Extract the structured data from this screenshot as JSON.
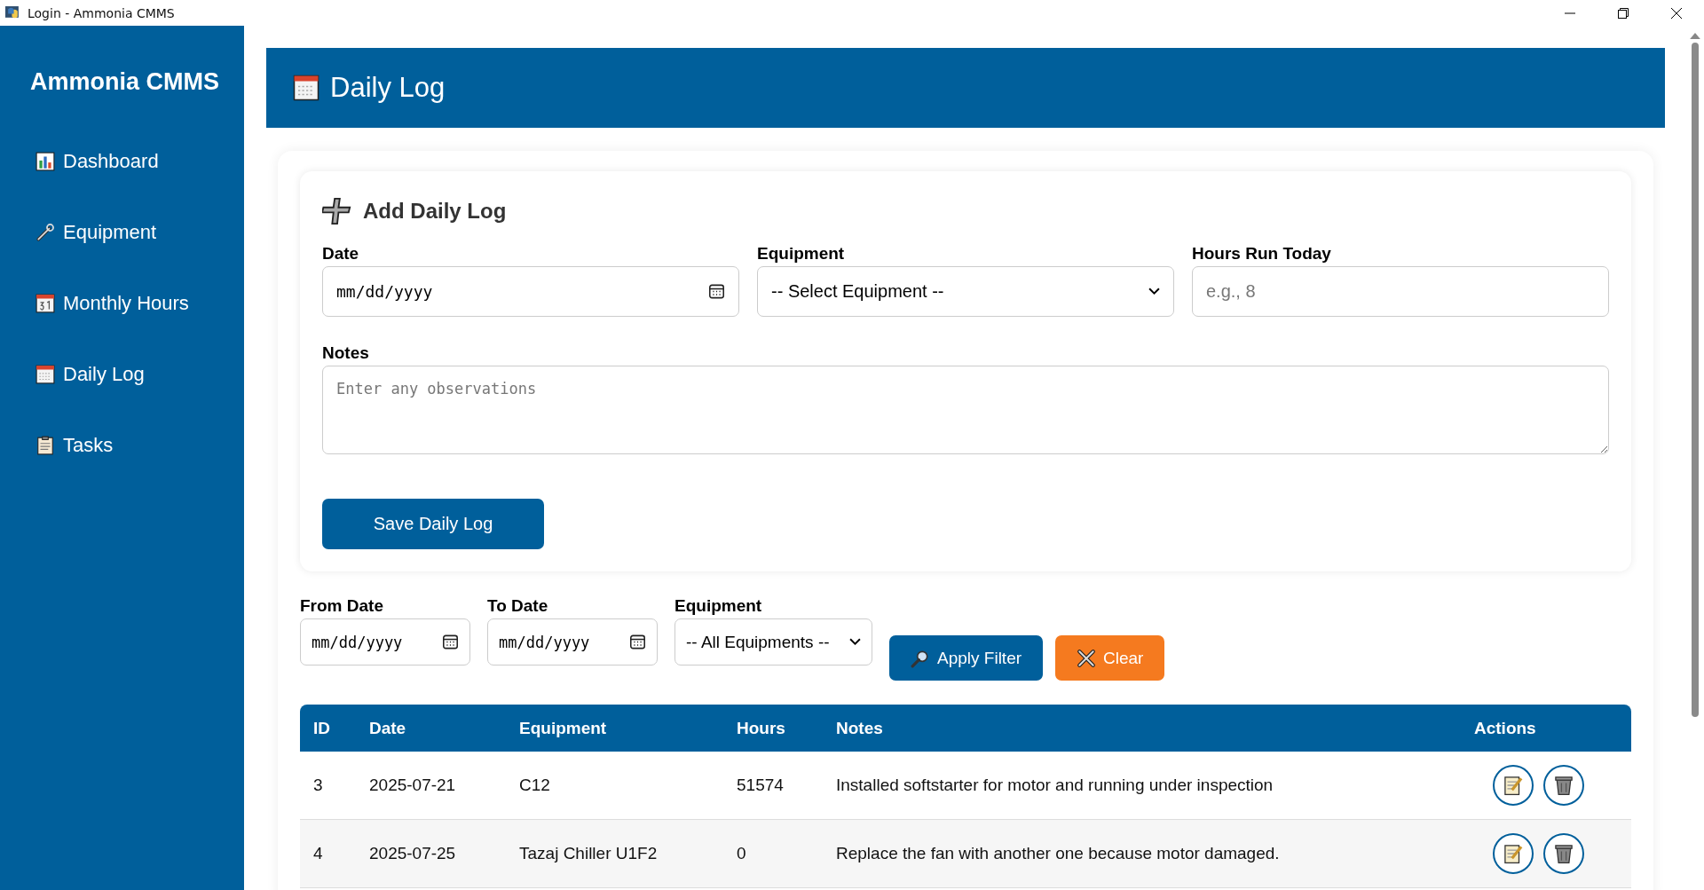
{
  "window": {
    "title": "Login - Ammonia CMMS"
  },
  "sidebar": {
    "title": "Ammonia CMMS",
    "items": [
      {
        "label": "Dashboard",
        "kind": "chart"
      },
      {
        "label": "Equipment",
        "kind": "wrench"
      },
      {
        "label": "Monthly Hours",
        "kind": "calendar31"
      },
      {
        "label": "Daily Log",
        "kind": "calendar"
      },
      {
        "label": "Tasks",
        "kind": "clipboard"
      }
    ]
  },
  "header": {
    "title": "Daily Log"
  },
  "form": {
    "title": "Add Daily Log",
    "date": {
      "label": "Date",
      "value": "mm/dd/yyyy"
    },
    "equipment": {
      "label": "Equipment",
      "value": "-- Select Equipment --"
    },
    "hours": {
      "label": "Hours Run Today",
      "placeholder": "e.g., 8"
    },
    "notes": {
      "label": "Notes",
      "placeholder": "Enter any observations"
    },
    "save_button": "Save Daily Log"
  },
  "filters": {
    "from": {
      "label": "From Date",
      "value": "mm/dd/yyyy"
    },
    "to": {
      "label": "To Date",
      "value": "mm/dd/yyyy"
    },
    "equipment": {
      "label": "Equipment",
      "value": "-- All Equipments --"
    },
    "apply_button": "Apply Filter",
    "clear_button": "Clear"
  },
  "table": {
    "columns": [
      "ID",
      "Date",
      "Equipment",
      "Hours",
      "Notes",
      "Actions"
    ],
    "rows": [
      {
        "id": "3",
        "date": "2025-07-21",
        "equipment": "C12",
        "hours": "51574",
        "notes": "Installed softstarter for motor and running under inspection"
      },
      {
        "id": "4",
        "date": "2025-07-25",
        "equipment": "Tazaj Chiller U1F2",
        "hours": "0",
        "notes": "Replace the fan with another one because motor damaged."
      }
    ]
  }
}
